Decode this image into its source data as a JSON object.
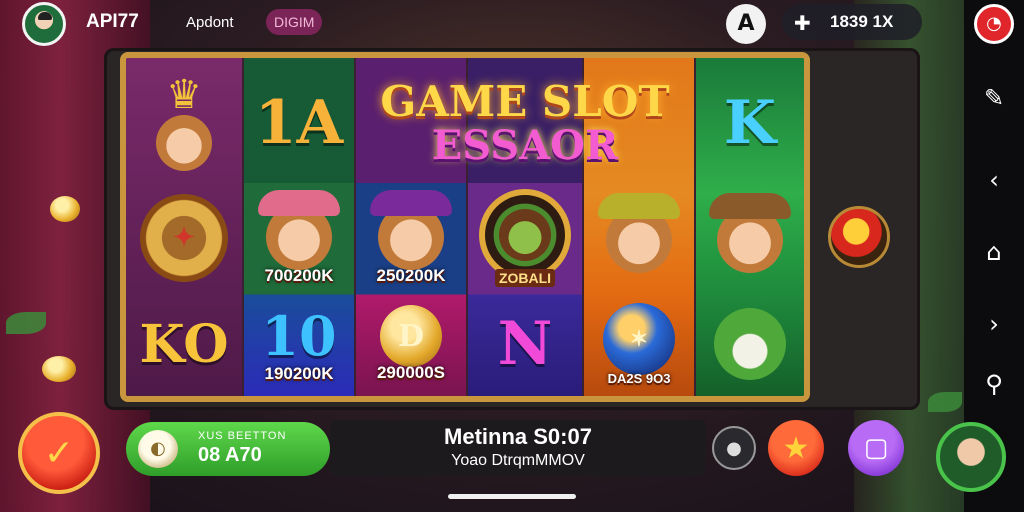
{
  "topbar": {
    "app_name": "API77",
    "nav_label": "Apdont",
    "nav_pill": "DIGIM",
    "round_icon": "A",
    "stats": "1839 1X"
  },
  "title": {
    "line1": "GAME SLOT",
    "line2": "ESSAOR"
  },
  "reels": {
    "col1": [
      "crown-king-symbol",
      "compass-symbol",
      "KO"
    ],
    "col2": {
      "top": "1A",
      "mid_label": "700200K",
      "bot_big": "10",
      "bot_label": "190200K"
    },
    "col3": {
      "mid_label": "250200K",
      "bot_coin": "D",
      "bot_label": "290000S"
    },
    "col4": {
      "mid_label": "ZOBALI",
      "bot_big": "N"
    },
    "col5": {
      "bot_label": "DA2S 9O3"
    },
    "col6": {
      "top": "K"
    }
  },
  "bottom": {
    "bet_label": "XUS BEETTON",
    "bet_value": "08 A70",
    "info_line1": "Metinna S0:07",
    "info_line2": "Yoao DtrqmMMOV"
  },
  "colors": {
    "frame_gold": "#c9953d",
    "bet_green": "#2f9e2a",
    "accent_red": "#d21f15",
    "accent_purple": "#7b2fd0"
  }
}
